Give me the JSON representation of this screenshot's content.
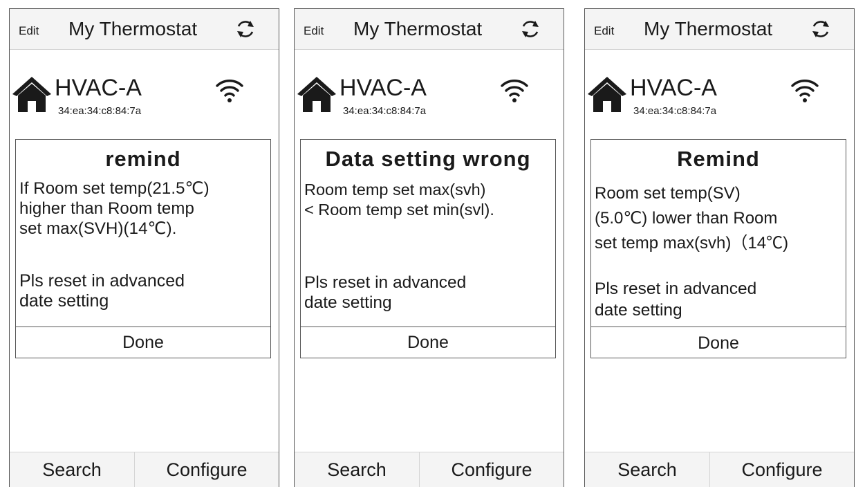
{
  "screens": [
    {
      "header": {
        "edit_label": "Edit",
        "title": "My Thermostat",
        "refresh_icon": "refresh-icon"
      },
      "device": {
        "name": "HVAC-A",
        "mac": "34:ea:34:c8:84:7a",
        "home_icon": "home-icon",
        "wifi_icon": "wifi-icon"
      },
      "dialog": {
        "title": "remind",
        "message": "If Room set temp(21.5℃)\nhigher than Room temp\nset max(SVH)(14℃).",
        "reset_note": "Pls reset in advanced\ndate setting",
        "done_label": "Done"
      },
      "footer": {
        "search_label": "Search",
        "configure_label": "Configure"
      }
    },
    {
      "header": {
        "edit_label": "Edit",
        "title": "My Thermostat",
        "refresh_icon": "refresh-icon"
      },
      "device": {
        "name": "HVAC-A",
        "mac": "34:ea:34:c8:84:7a",
        "home_icon": "home-icon",
        "wifi_icon": "wifi-icon"
      },
      "dialog": {
        "title": "Data setting wrong",
        "message": "Room temp set max(svh)\n< Room temp set min(svl).",
        "reset_note": "Pls reset in advanced\ndate setting",
        "done_label": "Done"
      },
      "footer": {
        "search_label": "Search",
        "configure_label": "Configure"
      }
    },
    {
      "header": {
        "edit_label": "Edit",
        "title": "My Thermostat",
        "refresh_icon": "refresh-icon"
      },
      "device": {
        "name": "HVAC-A",
        "mac": "34:ea:34:c8:84:7a",
        "home_icon": "home-icon",
        "wifi_icon": "wifi-icon"
      },
      "dialog": {
        "title": "Remind",
        "message": "Room set temp(SV)\n(5.0℃) lower than Room\nset temp max(svh)（14℃)",
        "reset_note": "Pls reset in advanced\ndate setting",
        "done_label": "Done"
      },
      "footer": {
        "search_label": "Search",
        "configure_label": "Configure"
      }
    }
  ]
}
